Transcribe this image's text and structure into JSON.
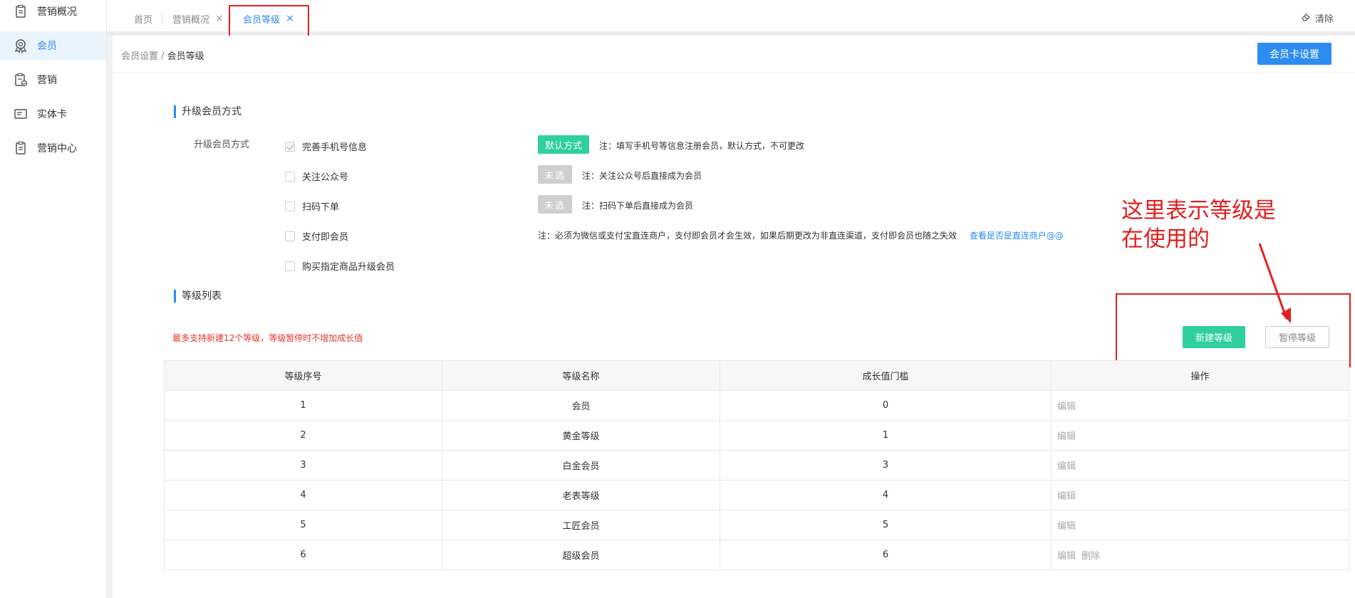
{
  "sidebar": {
    "items": [
      {
        "label": "营销概况",
        "icon": "clipboard-icon",
        "active": false
      },
      {
        "label": "会员",
        "icon": "member-badge-icon",
        "active": true
      },
      {
        "label": "营销",
        "icon": "clipboard-check-icon",
        "active": false
      },
      {
        "label": "实体卡",
        "icon": "card-icon",
        "active": false
      },
      {
        "label": "营销中心",
        "icon": "clipboard-icon",
        "active": false
      }
    ]
  },
  "tabs": [
    {
      "label": "首页",
      "closable": false,
      "active": false
    },
    {
      "label": "营销概况",
      "closable": true,
      "active": false
    },
    {
      "label": "会员等级",
      "closable": true,
      "active": true
    }
  ],
  "tab_close_glyph": "×",
  "clear_label": "清除",
  "breadcrumb": {
    "parent": "会员设置",
    "separator": " / ",
    "current": "会员等级"
  },
  "card_settings_button": "会员卡设置",
  "upgrade_section": {
    "title": "升级会员方式",
    "field_label": "升级会员方式",
    "options": [
      {
        "label": "完善手机号信息",
        "checked": true,
        "badge": "默认方式",
        "note": "注：填写手机号等信息注册会员，默认方式，不可更改"
      },
      {
        "label": "关注公众号",
        "checked": false,
        "badge": "未选",
        "note": "注：关注公众号后直接成为会员"
      },
      {
        "label": "扫码下单",
        "checked": false,
        "badge": "未选",
        "note": "注：扫码下单后直接成为会员"
      },
      {
        "label": "支付即会员",
        "checked": false,
        "badge": "",
        "note": "注：必须为微信或支付宝直连商户，支付即会员才会生效，如果后期更改为非直连渠道，支付即会员也随之失效",
        "link": "查看是否是直连商户@@"
      },
      {
        "label": "购买指定商品升级会员",
        "checked": false,
        "badge": "",
        "note": ""
      }
    ]
  },
  "level_section": {
    "title": "等级列表",
    "warning": "最多支持新建12个等级，等级暂停时不增加成长值",
    "new_button": "新建等级",
    "pause_button": "暂停等级",
    "annotation": "这里表示等级是在使用的",
    "columns": [
      "等级序号",
      "等级名称",
      "成长值门槛",
      "操作"
    ],
    "rows": [
      {
        "no": "1",
        "name": "会员",
        "threshold": "0",
        "ops": [
          "编辑"
        ]
      },
      {
        "no": "2",
        "name": "黄金等级",
        "threshold": "1",
        "ops": [
          "编辑"
        ]
      },
      {
        "no": "3",
        "name": "白金会员",
        "threshold": "3",
        "ops": [
          "编辑"
        ]
      },
      {
        "no": "4",
        "name": "老表等级",
        "threshold": "4",
        "ops": [
          "编辑"
        ]
      },
      {
        "no": "5",
        "name": "工匠会员",
        "threshold": "5",
        "ops": [
          "编辑"
        ]
      },
      {
        "no": "6",
        "name": "超级会员",
        "threshold": "6",
        "ops": [
          "编辑",
          "删除"
        ]
      }
    ]
  },
  "colors": {
    "accent": "#2d8cf0",
    "green": "#2fcf9e",
    "red": "#e02020"
  }
}
